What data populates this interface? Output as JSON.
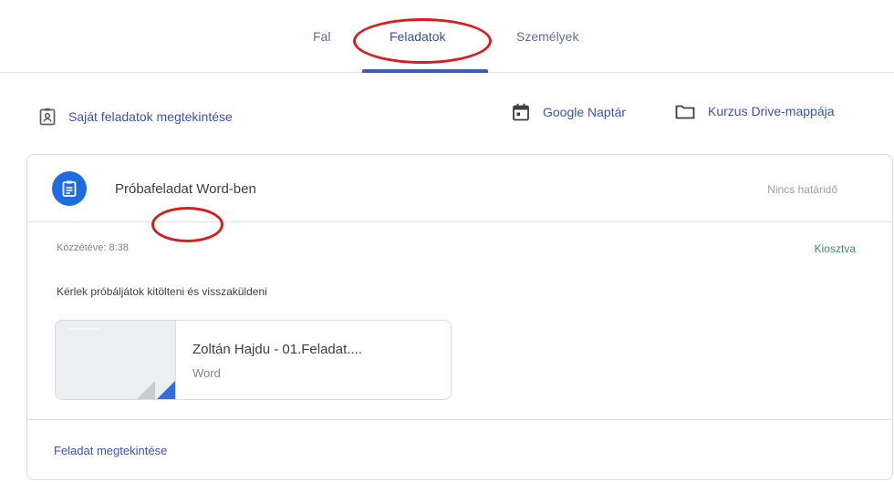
{
  "tabs": [
    {
      "label": "Fal"
    },
    {
      "label": "Feladatok",
      "active": true
    },
    {
      "label": "Személyek"
    }
  ],
  "toolbar": {
    "own_tasks": "Saját feladatok megtekintése",
    "calendar": "Google Naptár",
    "drive": "Kurzus Drive-mappája"
  },
  "assignment": {
    "title": "Próbafeladat Word-ben",
    "due": "Nincs határidő",
    "published": "Közzétéve: 8:38",
    "status": "Kiosztva",
    "instructions": "Kérlek próbáljátok kitölteni és visszaküldeni",
    "attachment": {
      "name": "Zoltán Hajdu - 01.Feladat....",
      "type": "Word"
    },
    "view_link": "Feladat megtekintése"
  },
  "colors": {
    "accent": "#3b5cc4",
    "link": "#3a55a8",
    "assign_icon_bg": "#1e6ce0",
    "status": "#3c8d5e",
    "annotation": "#d41f1f"
  },
  "icons": [
    "clipboard-user-icon",
    "calendar-icon",
    "folder-icon",
    "assignment-icon",
    "word-file-corner-icon"
  ]
}
